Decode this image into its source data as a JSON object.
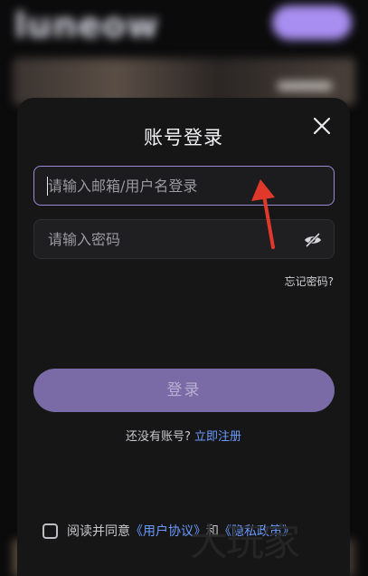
{
  "background": {
    "logo_text": "luneow"
  },
  "modal": {
    "title": "账号登录",
    "email_placeholder": "请输入邮箱/用户名登录",
    "password_placeholder": "请输入密码",
    "forgot_password": "忘记密码?",
    "login_button": "登录",
    "no_account_text": "还没有账号?",
    "register_link": "立即注册",
    "agree_prefix": "阅读并同意",
    "user_agreement": "《用户协议》",
    "and_text": "和",
    "privacy_policy": "《隐私政策》"
  },
  "watermark": "大玩家",
  "colors": {
    "accent": "#9c8ad6",
    "login_button": "#7a6aa5",
    "link": "#6a9bff",
    "arrow": "#e0392c"
  }
}
